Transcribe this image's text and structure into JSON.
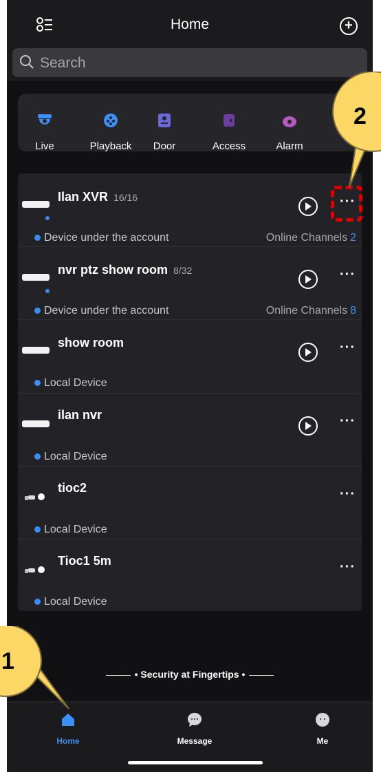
{
  "header": {
    "title": "Home",
    "add_label": "+"
  },
  "search": {
    "placeholder": "Search"
  },
  "quick_access": [
    {
      "label": "Live",
      "icon": "camera-icon",
      "color": "#3a8ef6"
    },
    {
      "label": "Playback",
      "icon": "playback-icon",
      "color": "#3a8ef6"
    },
    {
      "label": "Door",
      "icon": "door-icon",
      "color": "#6a6ad8"
    },
    {
      "label": "Access",
      "icon": "access-icon",
      "color": "#6b3fa0"
    },
    {
      "label": "Alarm",
      "icon": "alarm-icon",
      "color": "#b75abf"
    }
  ],
  "devices": [
    {
      "name": "Ilan XVR",
      "channels": "16/16",
      "sub": "Device under the account",
      "online_label": "Online Channels",
      "online_count": "2",
      "type": "recorder",
      "has_play": true
    },
    {
      "name": "nvr ptz show room",
      "channels": "8/32",
      "sub": "Device under the account",
      "online_label": "Online Channels",
      "online_count": "8",
      "type": "recorder",
      "has_play": true
    },
    {
      "name": "show room",
      "channels": "",
      "sub": "Local Device",
      "online_label": "",
      "online_count": "",
      "type": "recorder",
      "has_play": true
    },
    {
      "name": "ilan nvr",
      "channels": "",
      "sub": "Local Device",
      "online_label": "",
      "online_count": "",
      "type": "recorder",
      "has_play": true
    },
    {
      "name": "tioc2",
      "channels": "",
      "sub": "Local Device",
      "online_label": "",
      "online_count": "",
      "type": "camera",
      "has_play": false
    },
    {
      "name": "Tioc1 5m",
      "channels": "",
      "sub": "Local Device",
      "online_label": "",
      "online_count": "",
      "type": "camera",
      "has_play": false
    }
  ],
  "more_label": "···",
  "tagline": "• Security at Fingertips •",
  "tabs": [
    {
      "label": "Home",
      "active": true
    },
    {
      "label": "Message",
      "active": false
    },
    {
      "label": "Me",
      "active": false
    }
  ],
  "callouts": {
    "first": "1",
    "second": "2"
  },
  "colors": {
    "accent": "#3a8ef6",
    "callout": "#fcd766",
    "highlight": "#e00000"
  }
}
